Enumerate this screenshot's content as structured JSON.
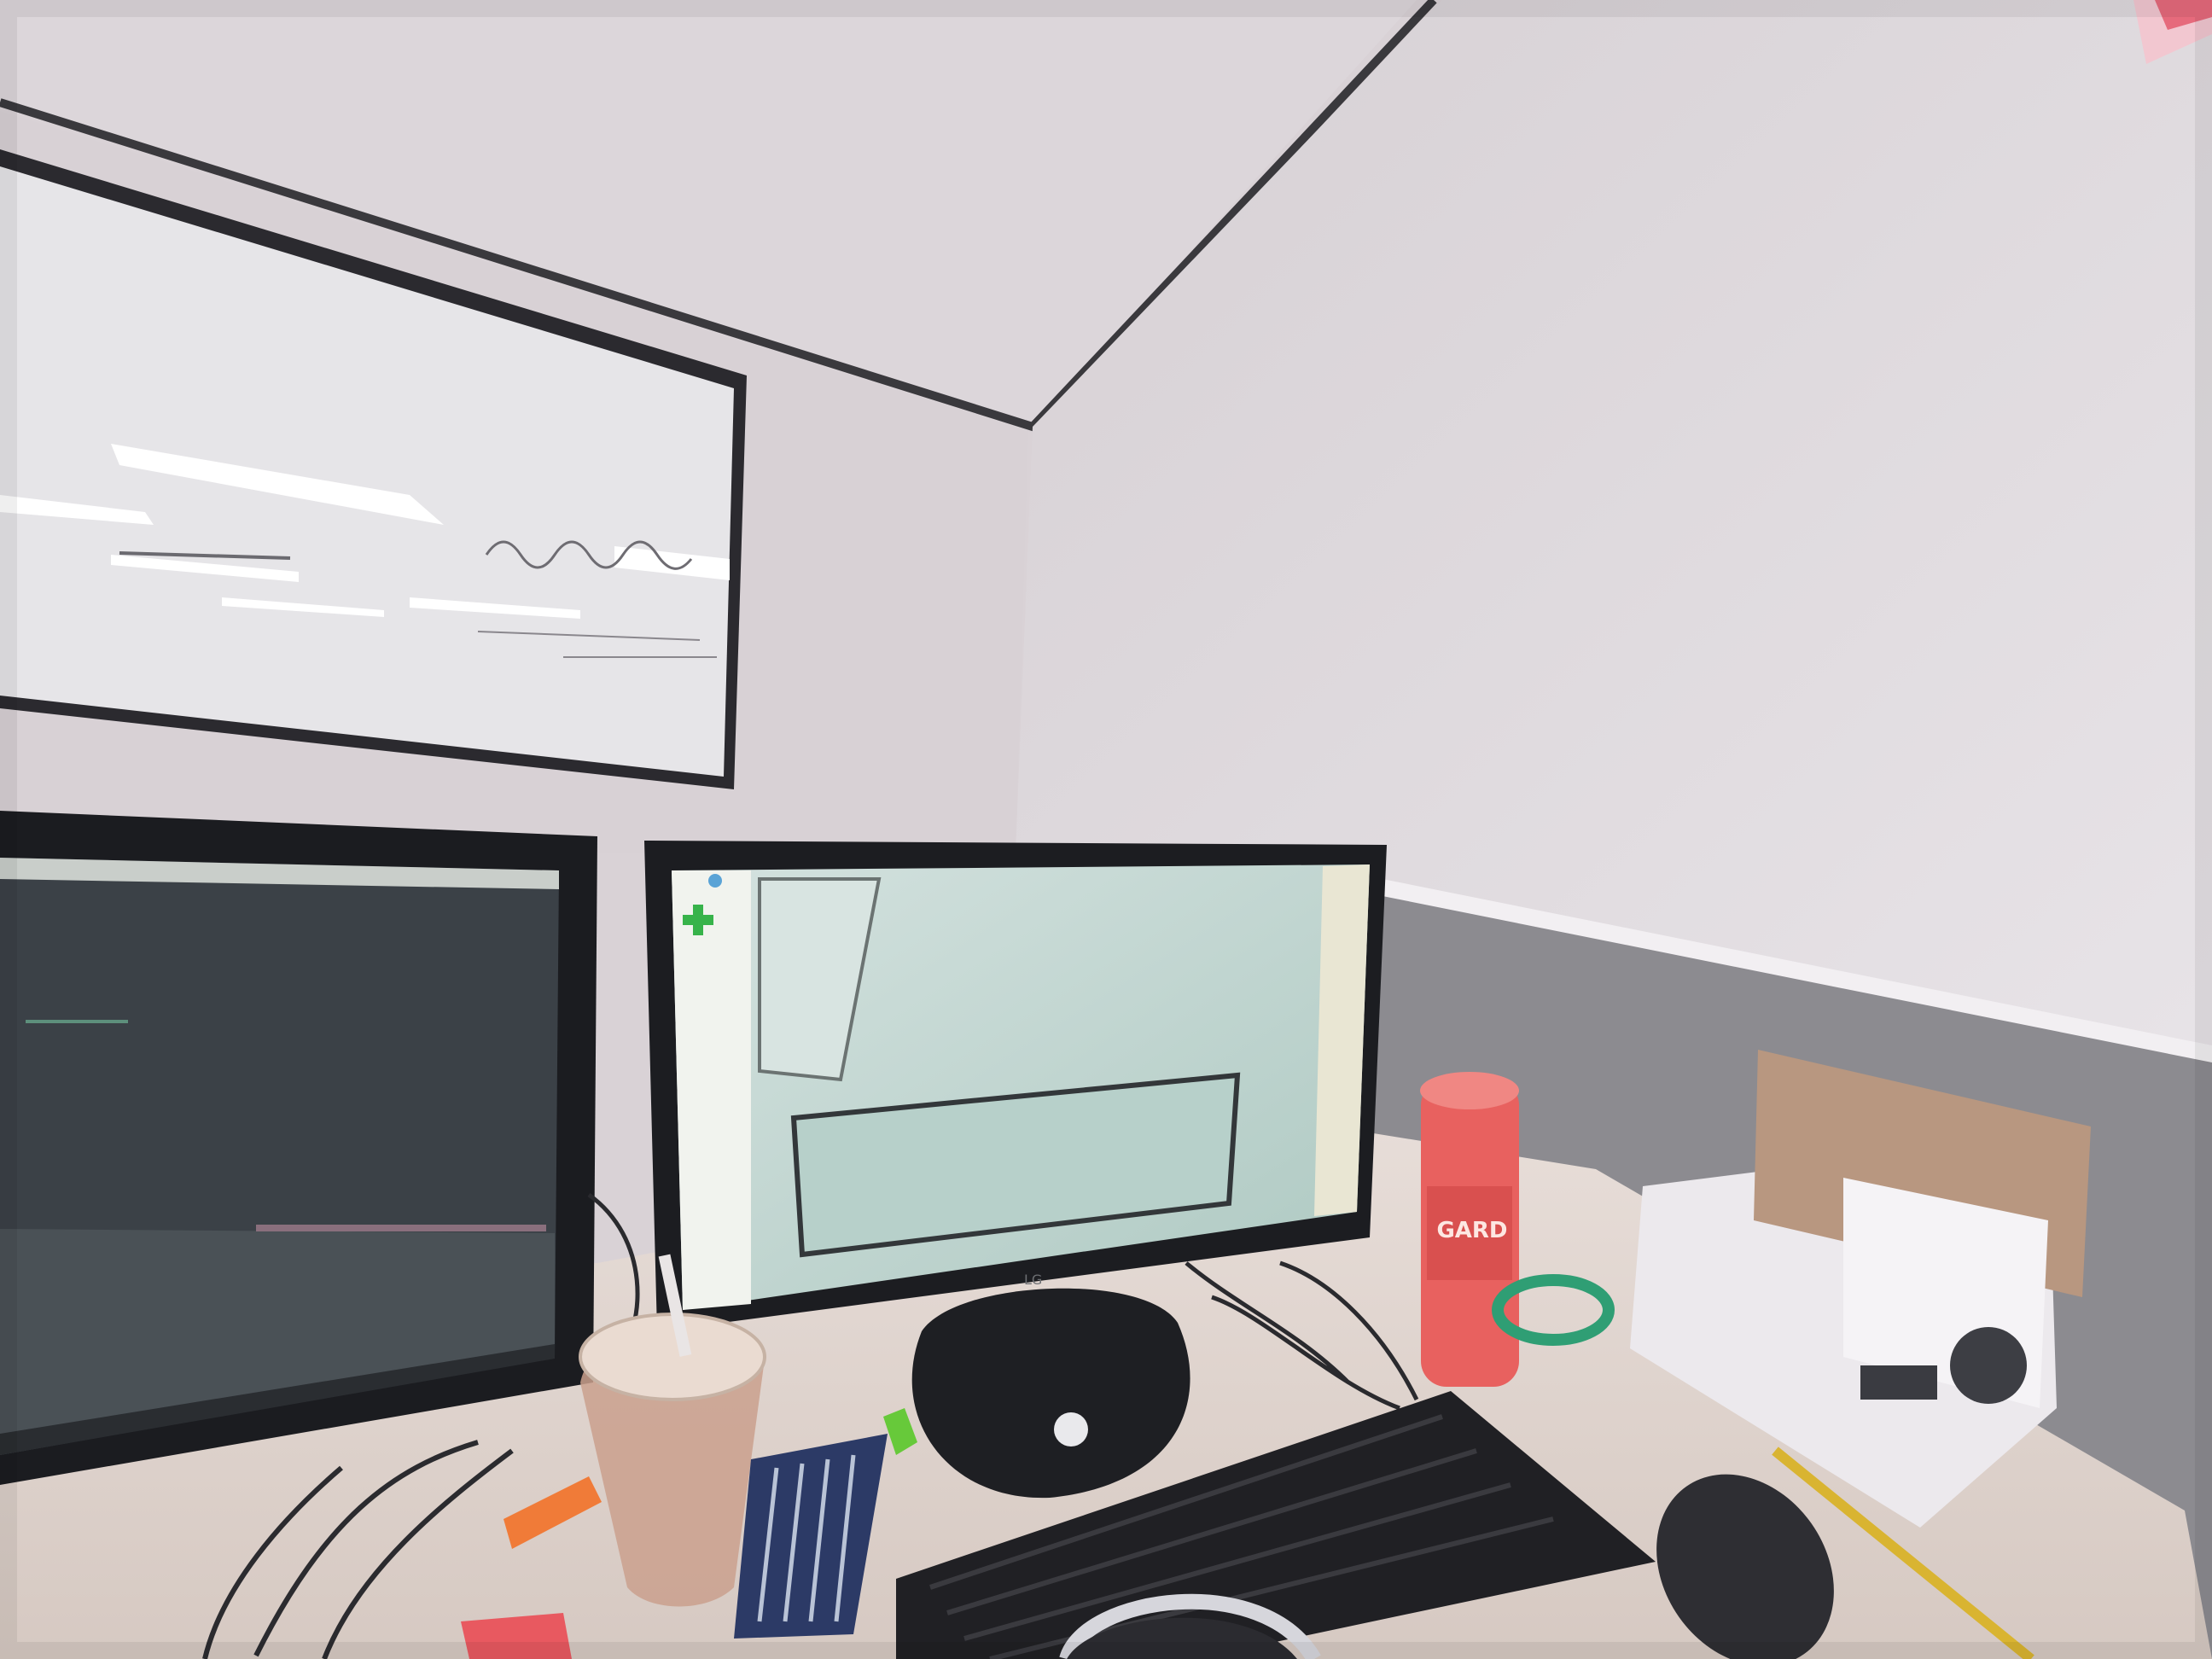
{
  "scene": {
    "description_visible_text": {
      "can_label": "GARD"
    },
    "colors": {
      "wall": "#e4dfe3",
      "ceiling": "#dcd7da",
      "whiteboard": "#e9e8ea",
      "desk": "#e2d8d3",
      "monitor_frame": "#1d1e22",
      "left_screen": "#3b4247",
      "right_screen": "#c8d8d4",
      "wall_base": "#8d8c91",
      "can": "#e8605e",
      "box": "#ece9ed",
      "cardboard": "#b9977f",
      "keyboard": "#212124"
    },
    "icons": [
      "green-plus-icon"
    ]
  }
}
